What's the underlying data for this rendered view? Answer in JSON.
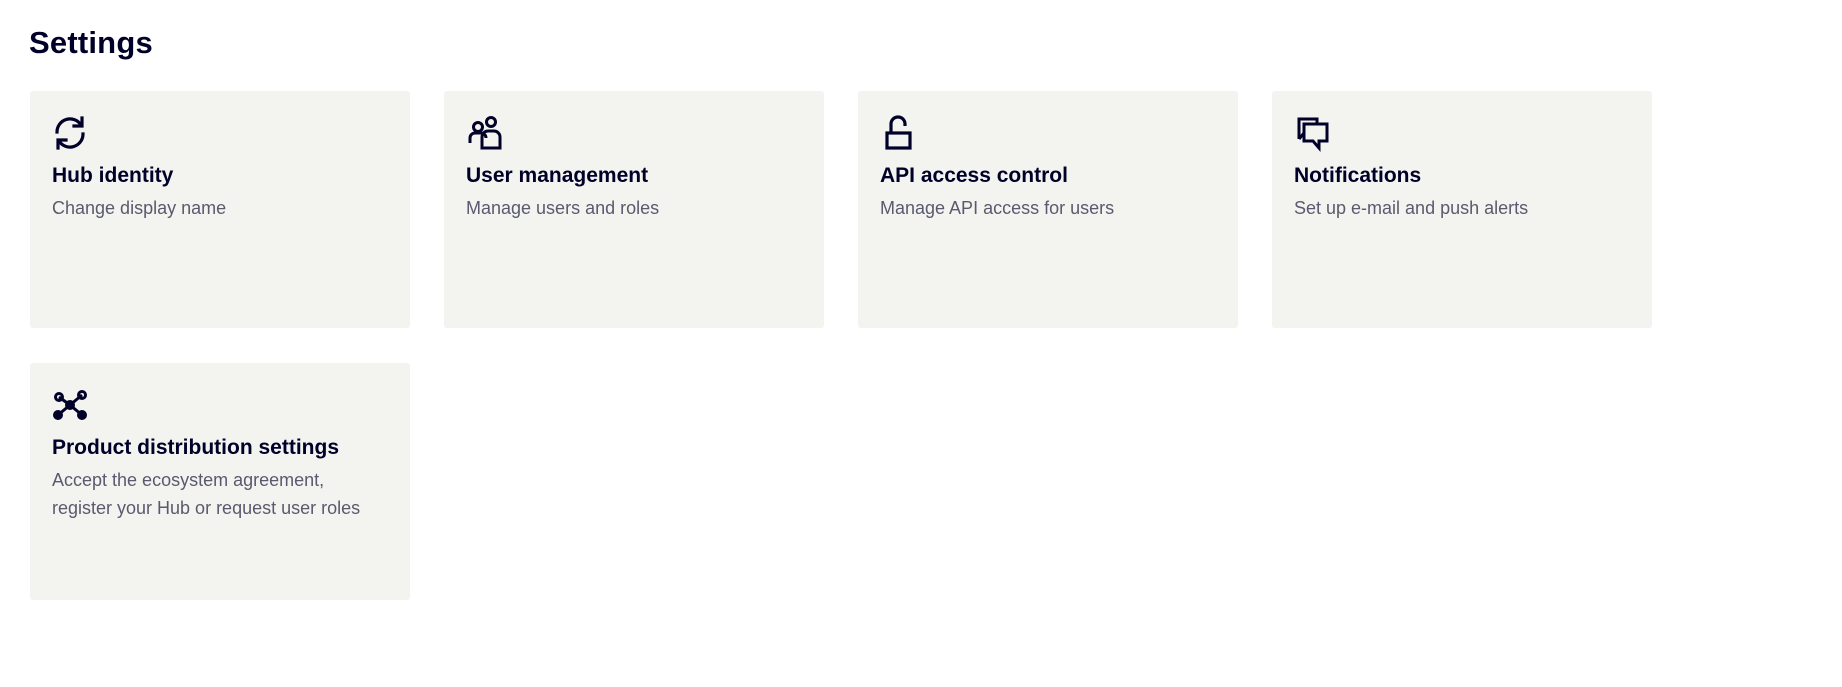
{
  "page": {
    "title": "Settings"
  },
  "cards": [
    {
      "icon": "refresh-icon",
      "title": "Hub identity",
      "description": "Change display name"
    },
    {
      "icon": "users-icon",
      "title": "User management",
      "description": "Manage users and roles"
    },
    {
      "icon": "unlock-icon",
      "title": "API access control",
      "description": "Manage API access for users"
    },
    {
      "icon": "chat-bubbles-icon",
      "title": "Notifications",
      "description": "Set up e-mail and push alerts"
    },
    {
      "icon": "network-icon",
      "title": "Product distribution settings",
      "description": "Accept the ecosystem agreement, register your Hub or request user roles"
    }
  ],
  "colors": {
    "text_primary": "#000028",
    "text_secondary": "#5a5a6e",
    "card_background": "#f3f3f0",
    "page_background": "#ffffff"
  }
}
